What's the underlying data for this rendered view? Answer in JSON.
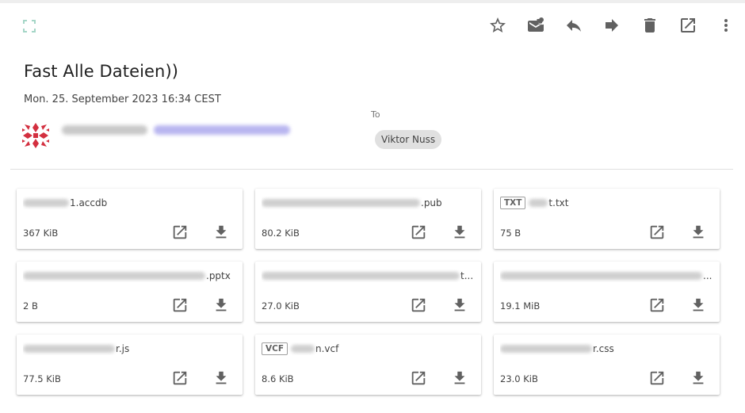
{
  "email": {
    "subject": "Fast Alle Dateien))",
    "date": "Mon. 25. September 2023 16:34 CEST",
    "to_label": "To",
    "recipient": "Viktor Nuss"
  },
  "toolbar": {
    "icons": [
      "star-icon",
      "mail-unread-icon",
      "reply-icon",
      "forward-icon",
      "delete-icon",
      "open-external-icon",
      "more-vert-icon"
    ]
  },
  "colors": {
    "icon": "#616161",
    "avatar": "#d32f3f",
    "expand_icon": "#a5d6c7",
    "chip_bg": "#e0e0e0"
  },
  "attachments": [
    {
      "tag": "",
      "name_suffix": "1.accdb",
      "size": "367 KiB"
    },
    {
      "tag": "",
      "name_suffix": ".pub",
      "size": "80.2 KiB"
    },
    {
      "tag": "TXT",
      "name_suffix": "t.txt",
      "size": "75 B"
    },
    {
      "tag": "",
      "name_suffix": ".pptx",
      "size": "2 B"
    },
    {
      "tag": "",
      "name_suffix": "t...",
      "size": "27.0 KiB"
    },
    {
      "tag": "",
      "name_suffix": "...",
      "size": "19.1 MiB"
    },
    {
      "tag": "",
      "name_suffix": "r.js",
      "size": "77.5 KiB"
    },
    {
      "tag": "VCF",
      "name_suffix": "n.vcf",
      "size": "8.6 KiB"
    },
    {
      "tag": "",
      "name_suffix": "r.css",
      "size": "23.0 KiB"
    }
  ]
}
